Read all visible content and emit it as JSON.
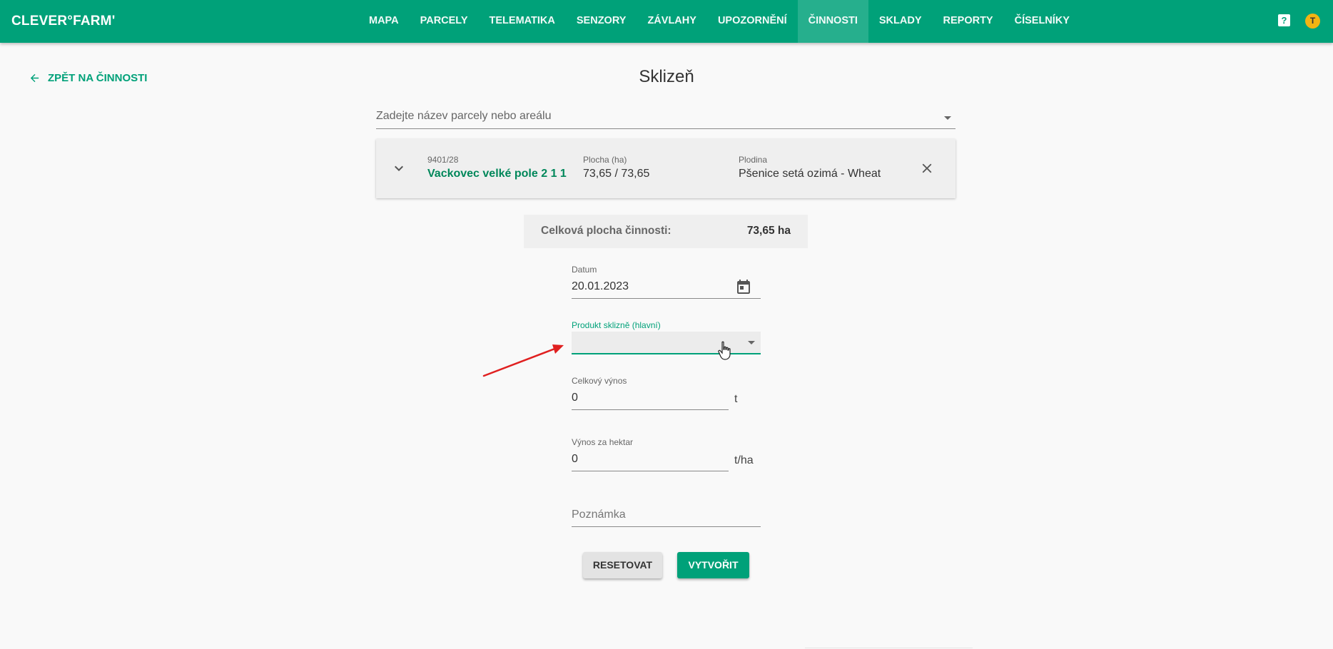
{
  "app": {
    "logo": "CLEVER°FARM'"
  },
  "nav": {
    "items": [
      {
        "label": "MAPA"
      },
      {
        "label": "PARCELY"
      },
      {
        "label": "TELEMATIKA"
      },
      {
        "label": "SENZORY"
      },
      {
        "label": "ZÁVLAHY"
      },
      {
        "label": "UPOZORNĚNÍ"
      },
      {
        "label": "ČINNOSTI",
        "active": true
      },
      {
        "label": "SKLADY"
      },
      {
        "label": "REPORTY"
      },
      {
        "label": "ČÍSELNÍKY"
      }
    ],
    "help_icon": "?",
    "avatar_initial": "T"
  },
  "header": {
    "back_label": "ZPĚT NA ČINNOSTI",
    "title": "Sklizeň"
  },
  "parcel_search": {
    "placeholder": "Zadejte název parcely nebo areálu"
  },
  "parcel_card": {
    "id": "9401/28",
    "name": "Vackovec velké pole 2 1 1",
    "area_label": "Plocha (ha)",
    "area_value": "73,65 / 73,65",
    "crop_label": "Plodina",
    "crop_value": "Pšenice setá ozimá - Wheat"
  },
  "total": {
    "label": "Celková plocha činnosti:",
    "value": "73,65 ha"
  },
  "form": {
    "date_label": "Datum",
    "date_value": "20.01.2023",
    "product_label": "Produkt sklizně (hlavní)",
    "total_yield_label": "Celkový výnos",
    "total_yield_value": "0",
    "total_yield_unit": "t",
    "yield_per_ha_label": "Výnos za hektar",
    "yield_per_ha_value": "0",
    "yield_per_ha_unit": "t/ha",
    "note_placeholder": "Poznámka"
  },
  "buttons": {
    "reset": "RESETOVAT",
    "create": "VYTVOŘIT"
  },
  "colors": {
    "primary": "#00a179",
    "avatar": "#f2b413",
    "annotation_arrow": "#e02020"
  }
}
